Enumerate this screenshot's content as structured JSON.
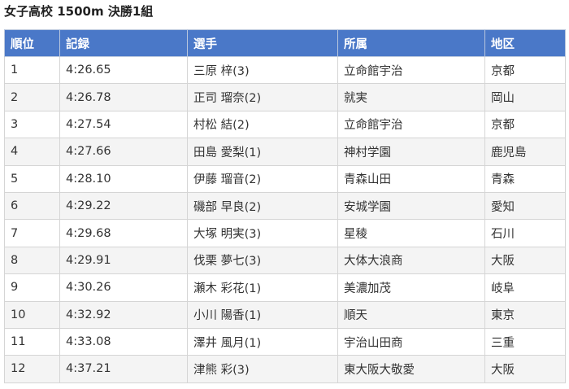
{
  "page": {
    "title": "女子高校 1500m 決勝1組"
  },
  "table": {
    "headers": [
      "順位",
      "記録",
      "選手",
      "所属",
      "地区"
    ],
    "rows": [
      [
        "1",
        "4:26.65",
        "三原 梓(3)",
        "立命館宇治",
        "京都"
      ],
      [
        "2",
        "4:26.78",
        "正司 瑠奈(2)",
        "就実",
        "岡山"
      ],
      [
        "3",
        "4:27.54",
        "村松 結(2)",
        "立命館宇治",
        "京都"
      ],
      [
        "4",
        "4:27.66",
        "田島 愛梨(1)",
        "神村学園",
        "鹿児島"
      ],
      [
        "5",
        "4:28.10",
        "伊藤 瑠音(2)",
        "青森山田",
        "青森"
      ],
      [
        "6",
        "4:29.22",
        "磯部 早良(2)",
        "安城学園",
        "愛知"
      ],
      [
        "7",
        "4:29.68",
        "大塚 明実(3)",
        "星稜",
        "石川"
      ],
      [
        "8",
        "4:29.91",
        "伐栗 夢七(3)",
        "大体大浪商",
        "大阪"
      ],
      [
        "9",
        "4:30.26",
        "瀬木 彩花(1)",
        "美濃加茂",
        "岐阜"
      ],
      [
        "10",
        "4:32.92",
        "小川 陽香(1)",
        "順天",
        "東京"
      ],
      [
        "11",
        "4:33.08",
        "澤井 風月(1)",
        "宇治山田商",
        "三重"
      ],
      [
        "12",
        "4:37.21",
        "津熊 彩(3)",
        "東大阪大敬愛",
        "大阪"
      ]
    ]
  },
  "colors": {
    "header_bg": "#4a78c8",
    "header_text": "#ffffff",
    "row_alt_bg": "#f4f4f4",
    "border": "#d5d5d5"
  }
}
